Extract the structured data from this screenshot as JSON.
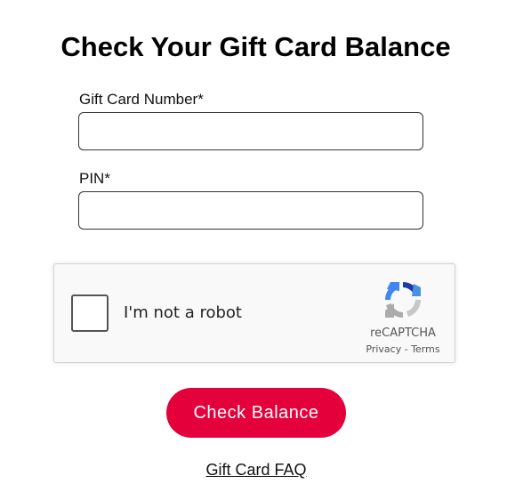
{
  "page": {
    "title": "Check Your Gift Card Balance"
  },
  "form": {
    "card_number_label": "Gift Card Number*",
    "card_number_value": "",
    "pin_label": "PIN*",
    "pin_value": "",
    "submit_label": "Check Balance",
    "submit_color": "#e4003b"
  },
  "recaptcha": {
    "checkbox_label": "I'm not a robot",
    "brand": "reCAPTCHA",
    "privacy_label": "Privacy",
    "separator": " - ",
    "terms_label": "Terms",
    "icon": "recaptcha-logo-icon"
  },
  "footer": {
    "faq_link_label": "Gift Card FAQ"
  }
}
